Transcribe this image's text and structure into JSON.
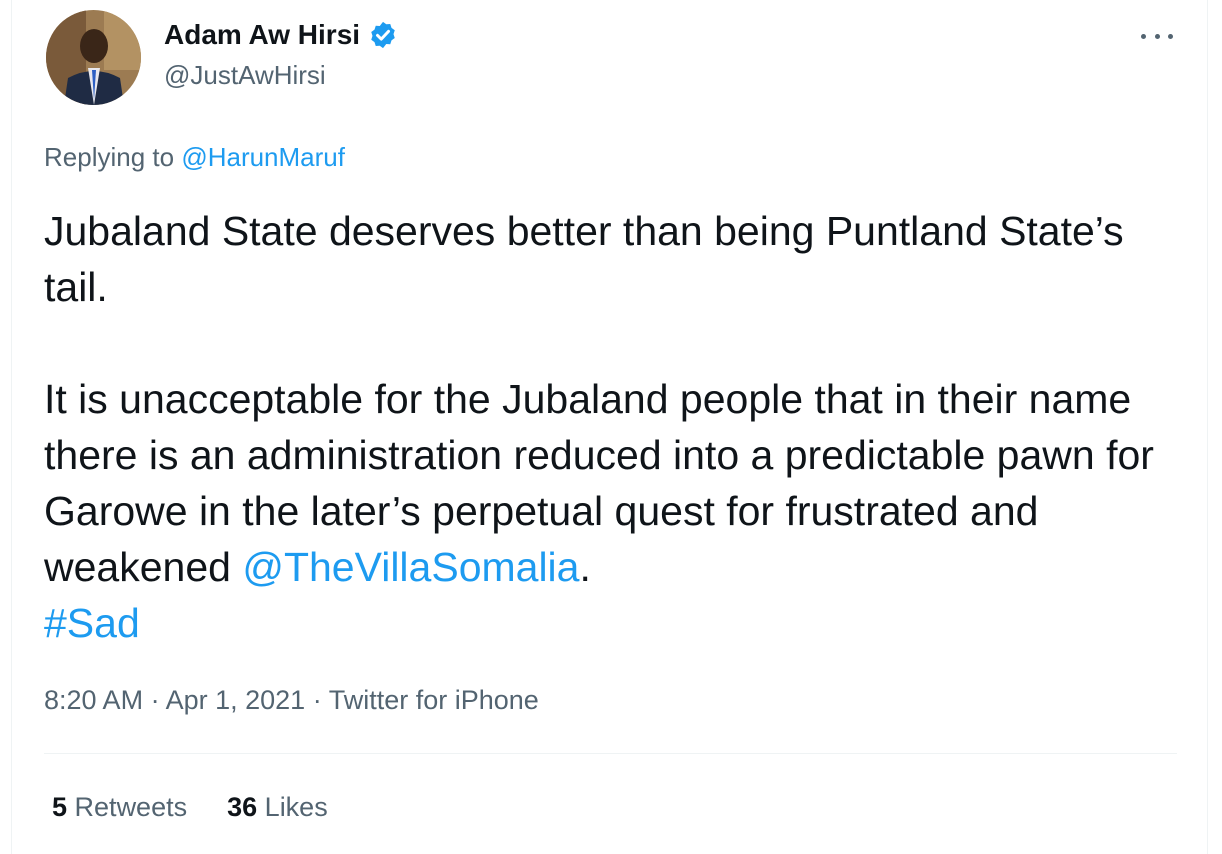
{
  "author": {
    "name": "Adam Aw Hirsi",
    "handle": "@JustAwHirsi",
    "verified": true
  },
  "reply": {
    "prefix": "Replying to",
    "to": "@HarunMaruf"
  },
  "tweet": {
    "para1": "Jubaland State deserves better than being Puntland State’s tail.",
    "para2_text": "It is unacceptable for the Jubaland people that in their name there is an administration reduced into a predictable pawn for Garowe in the later’s perpetual quest for frustrated and weakened",
    "mention": "@TheVillaSomalia",
    "period": ".",
    "hashtag": "#Sad"
  },
  "meta": {
    "time": "8:20 AM",
    "date": "Apr 1, 2021",
    "source": "Twitter for iPhone",
    "separator": "·"
  },
  "stats": {
    "retweets_count": "5",
    "retweets_label": "Retweets",
    "likes_count": "36",
    "likes_label": "Likes"
  },
  "colors": {
    "link": "#1d9bf0",
    "secondary_text": "#536471",
    "primary_text": "#0f1419"
  },
  "icons": {
    "verified": "verified-badge-icon",
    "more": "more-horizontal-icon"
  }
}
